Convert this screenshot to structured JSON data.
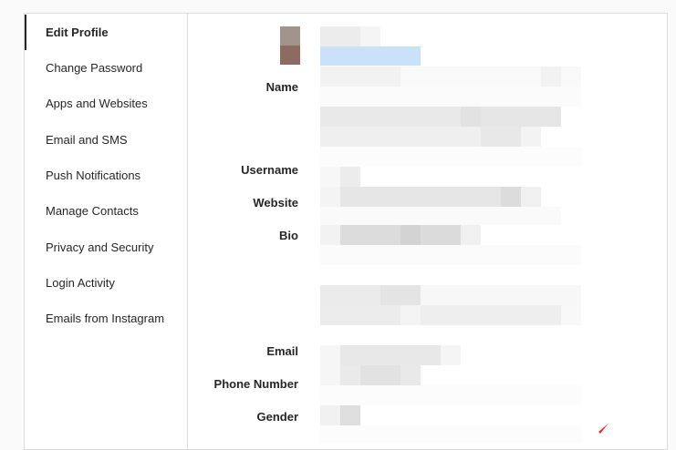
{
  "sidebar": {
    "items": [
      {
        "label": "Edit Profile",
        "active": true
      },
      {
        "label": "Change Password",
        "active": false
      },
      {
        "label": "Apps and Websites",
        "active": false
      },
      {
        "label": "Email and SMS",
        "active": false
      },
      {
        "label": "Push Notifications",
        "active": false
      },
      {
        "label": "Manage Contacts",
        "active": false
      },
      {
        "label": "Privacy and Security",
        "active": false
      },
      {
        "label": "Login Activity",
        "active": false
      },
      {
        "label": "Emails from Instagram",
        "active": false
      }
    ]
  },
  "form": {
    "labels": {
      "name": "Name",
      "username": "Username",
      "website": "Website",
      "bio": "Bio",
      "email": "Email",
      "phone": "Phone Number",
      "gender": "Gender"
    }
  },
  "colors": {
    "border": "#dbdbdb",
    "text": "#262626",
    "link_blur": "#c9e1f9",
    "avatar_top": "#a1958b",
    "avatar_bottom": "#8d6b61",
    "checkmark": "#e0322b"
  }
}
